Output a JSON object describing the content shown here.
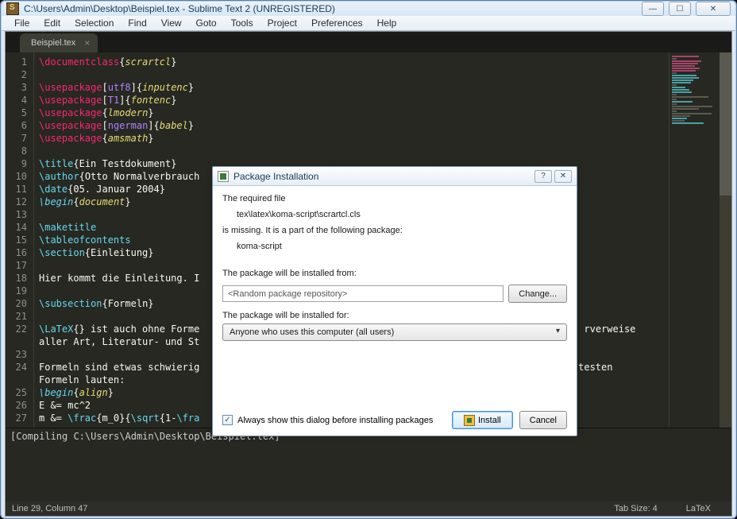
{
  "window": {
    "title": "C:\\Users\\Admin\\Desktop\\Beispiel.tex - Sublime Text 2 (UNREGISTERED)"
  },
  "menu": {
    "file": "File",
    "edit": "Edit",
    "selection": "Selection",
    "find": "Find",
    "view": "View",
    "goto": "Goto",
    "tools": "Tools",
    "project": "Project",
    "preferences": "Preferences",
    "help": "Help"
  },
  "tabs": {
    "active": "Beispiel.tex"
  },
  "code": {
    "l1a": "\\documentclass",
    "l1b": "scrartcl",
    "l3a": "\\usepackage",
    "l3opt": "utf8",
    "l3b": "inputenc",
    "l4a": "\\usepackage",
    "l4opt": "T1",
    "l4b": "fontenc",
    "l5a": "\\usepackage",
    "l5b": "lmodern",
    "l6a": "\\usepackage",
    "l6opt": "ngerman",
    "l6b": "babel",
    "l7a": "\\usepackage",
    "l7b": "amsmath",
    "l9a": "\\title",
    "l9b": "Ein Testdokument",
    "l10a": "\\author",
    "l10b": "Otto Normalverbrauch",
    "l11a": "\\date",
    "l11b": "05. Januar 2004",
    "l12a": "\\begin",
    "l12b": "document",
    "l14": "\\maketitle",
    "l15": "\\tableofcontents",
    "l16a": "\\section",
    "l16b": "Einleitung",
    "l18": "Hier kommt die Einleitung. I",
    "l20a": "\\subsection",
    "l20b": "Formeln",
    "l22a": "\\LaTeX",
    "l22b": "{} ist auch ohne Forme",
    "l22c": "rverweise",
    "l22d": "aller Art, Literatur- und St",
    "l24a": "Formeln sind etwas schwierig",
    "l24b": "testen",
    "l24c": "Formeln lauten:",
    "l25a": "\\begin",
    "l25b": "align",
    "l26": "E &= mc^2",
    "l27a": "m &= ",
    "l27b": "\\frac",
    "l27c": "m_0",
    "l27d": "\\sqrt",
    "l27e": "1-",
    "l27f": "\\fra"
  },
  "compile": "[Compiling C:\\Users\\Admin\\Desktop\\Beispiel.tex]",
  "status": {
    "pos": "Line 29, Column 47",
    "tab": "Tab Size: 4",
    "lang": "LaTeX"
  },
  "dialog": {
    "title": "Package Installation",
    "line1": "The required file",
    "filepath": "tex\\latex\\koma-script\\scrartcl.cls",
    "line2": "is missing. It is a part of the following package:",
    "pkgname": "koma-script",
    "installed_from_lbl": "The package will be installed from:",
    "repo_value": "<Random package repository>",
    "change_btn": "Change...",
    "installed_for_lbl": "The package will be installed for:",
    "scope_value": "Anyone who uses this computer (all users)",
    "checkbox_label": "Always show this dialog before installing packages",
    "install_btn": "Install",
    "cancel_btn": "Cancel"
  }
}
